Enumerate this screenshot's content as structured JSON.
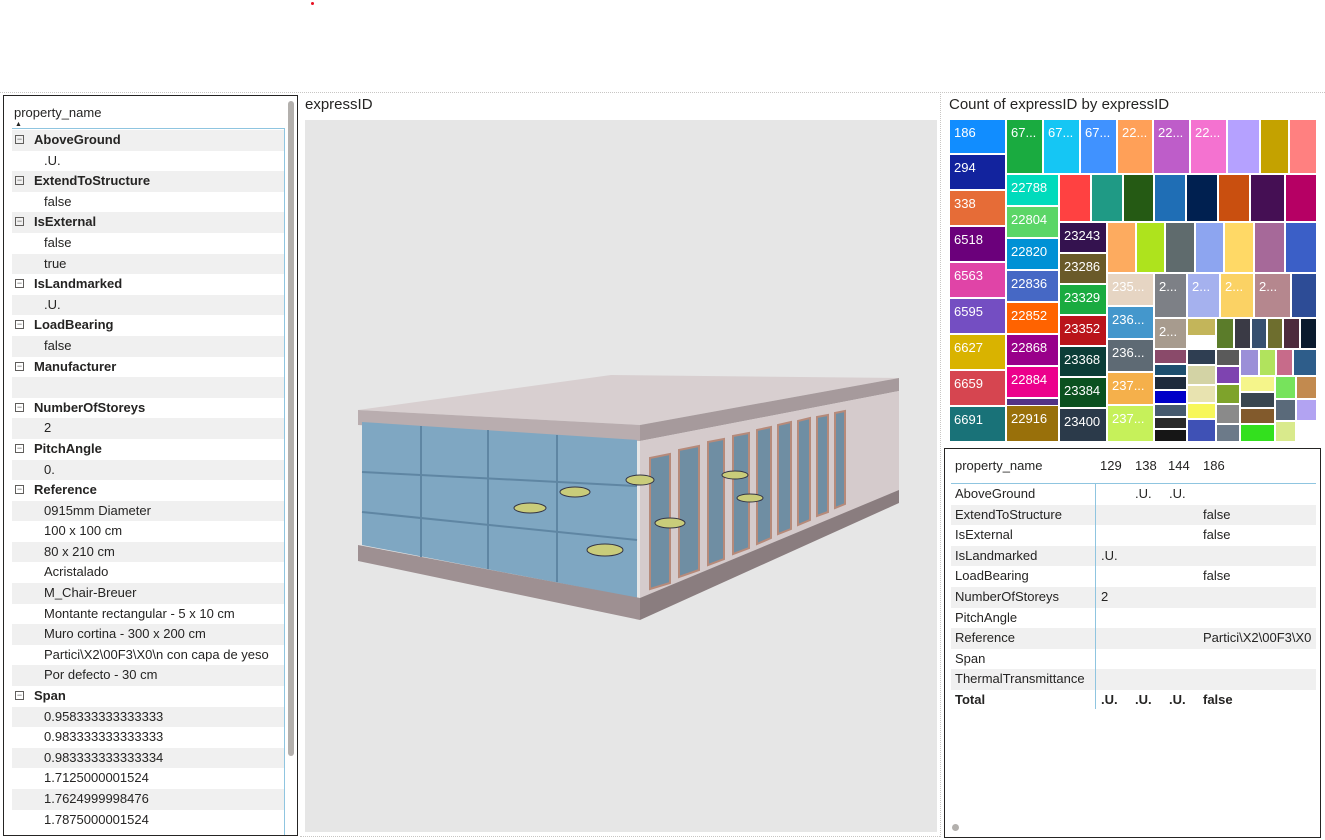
{
  "slicer": {
    "header": "property_name",
    "rows": [
      {
        "type": "cat",
        "text": "AboveGround"
      },
      {
        "type": "val",
        "text": ".U."
      },
      {
        "type": "cat",
        "text": "ExtendToStructure"
      },
      {
        "type": "val",
        "text": "false"
      },
      {
        "type": "cat",
        "text": "IsExternal"
      },
      {
        "type": "val",
        "text": "false"
      },
      {
        "type": "val",
        "text": "true"
      },
      {
        "type": "cat",
        "text": "IsLandmarked"
      },
      {
        "type": "val",
        "text": ".U."
      },
      {
        "type": "cat",
        "text": "LoadBearing"
      },
      {
        "type": "val",
        "text": "false"
      },
      {
        "type": "cat",
        "text": "Manufacturer"
      },
      {
        "type": "val",
        "text": ""
      },
      {
        "type": "cat",
        "text": "NumberOfStoreys"
      },
      {
        "type": "val",
        "text": "2"
      },
      {
        "type": "cat",
        "text": "PitchAngle"
      },
      {
        "type": "val",
        "text": "0."
      },
      {
        "type": "cat",
        "text": "Reference"
      },
      {
        "type": "val",
        "text": "0915mm Diameter"
      },
      {
        "type": "val",
        "text": "100 x 100 cm"
      },
      {
        "type": "val",
        "text": "80 x 210 cm"
      },
      {
        "type": "val",
        "text": "Acristalado"
      },
      {
        "type": "val",
        "text": "M_Chair-Breuer"
      },
      {
        "type": "val",
        "text": "Montante rectangular - 5 x 10 cm"
      },
      {
        "type": "val",
        "text": "Muro cortina - 300 x 200 cm"
      },
      {
        "type": "val",
        "text": "Partici\\X2\\00F3\\X0\\n con capa de yeso"
      },
      {
        "type": "val",
        "text": "Por defecto - 30 cm"
      },
      {
        "type": "cat",
        "text": "Span"
      },
      {
        "type": "val",
        "text": "0.958333333333333"
      },
      {
        "type": "val",
        "text": "0.983333333333333"
      },
      {
        "type": "val",
        "text": "0.983333333333334"
      },
      {
        "type": "val",
        "text": "1.7125000001524"
      },
      {
        "type": "val",
        "text": "1.7624999998476"
      },
      {
        "type": "val",
        "text": "1.7875000001524"
      }
    ]
  },
  "viewer": {
    "title": "expressID"
  },
  "treemap": {
    "title": "Count of expressID by expressID",
    "cells": [
      {
        "label": "186",
        "color": "#118dff"
      },
      {
        "label": "294",
        "color": "#12239e"
      },
      {
        "label": "338",
        "color": "#e66c37"
      },
      {
        "label": "6518",
        "color": "#6b007b"
      },
      {
        "label": "6563",
        "color": "#e044a7"
      },
      {
        "label": "6595",
        "color": "#744ec2"
      },
      {
        "label": "6627",
        "color": "#d9b300"
      },
      {
        "label": "6659",
        "color": "#d64550"
      },
      {
        "label": "6691",
        "color": "#197278"
      },
      {
        "label": "67...",
        "color": "#1aab40"
      },
      {
        "label": "67...",
        "color": "#15c6f4"
      },
      {
        "label": "67...",
        "color": "#4092ff"
      },
      {
        "label": "22...",
        "color": "#ffa058"
      },
      {
        "label": "22...",
        "color": "#be5dc9"
      },
      {
        "label": "22...",
        "color": "#f472d0"
      },
      {
        "label": "",
        "color": "#b5a1ff"
      },
      {
        "label": "",
        "color": "#c4a200"
      },
      {
        "label": "",
        "color": "#ff8080"
      },
      {
        "label": "22788",
        "color": "#00dbbc"
      },
      {
        "label": "22804",
        "color": "#5bd667"
      },
      {
        "label": "22820",
        "color": "#0091d5"
      },
      {
        "label": "22836",
        "color": "#4668c5"
      },
      {
        "label": "22852",
        "color": "#ff6300"
      },
      {
        "label": "22868",
        "color": "#99008a"
      },
      {
        "label": "22884",
        "color": "#ec008c"
      },
      {
        "label": "22900",
        "color": "#533285"
      },
      {
        "label": "22916",
        "color": "#99700a"
      },
      {
        "label": "",
        "color": "#ff4141"
      },
      {
        "label": "",
        "color": "#1f9a85"
      },
      {
        "label": "",
        "color": "#255a14"
      },
      {
        "label": "",
        "color": "#1f6eb5"
      },
      {
        "label": "",
        "color": "#002050"
      },
      {
        "label": "",
        "color": "#c94f0f"
      },
      {
        "label": "",
        "color": "#450f54"
      },
      {
        "label": "",
        "color": "#b60064"
      },
      {
        "label": "23243",
        "color": "#34124f"
      },
      {
        "label": "23286",
        "color": "#6a5a29"
      },
      {
        "label": "23329",
        "color": "#1aab40"
      },
      {
        "label": "23352",
        "color": "#ba141a"
      },
      {
        "label": "23368",
        "color": "#0c3d37"
      },
      {
        "label": "23384",
        "color": "#0b511f"
      },
      {
        "label": "23400",
        "color": "#2b3a4a"
      },
      {
        "label": "",
        "color": "#fdab5f"
      },
      {
        "label": "",
        "color": "#aee31d"
      },
      {
        "label": "",
        "color": "#5f6b6d"
      },
      {
        "label": "",
        "color": "#8da5f0"
      },
      {
        "label": "",
        "color": "#ffd966"
      },
      {
        "label": "",
        "color": "#a66999"
      },
      {
        "label": "",
        "color": "#3b5fc7"
      },
      {
        "label": "235...",
        "color": "#e6d5c3"
      },
      {
        "label": "236...",
        "color": "#4497cc"
      },
      {
        "label": "236...",
        "color": "#5e6a74"
      },
      {
        "label": "237...",
        "color": "#f5b04b"
      },
      {
        "label": "237...",
        "color": "#c6f15a"
      },
      {
        "label": "2...",
        "color": "#7d8086"
      },
      {
        "label": "2...",
        "color": "#a5b1ee"
      },
      {
        "label": "2...",
        "color": "#fbd264"
      },
      {
        "label": "2...",
        "color": "#b5878e"
      },
      {
        "label": "",
        "color": "#2d4c96"
      },
      {
        "label": "2...",
        "color": "#a79b8e"
      },
      {
        "label": "",
        "color": "#c3b55a"
      },
      {
        "label": "",
        "color": "#5b7c2a"
      },
      {
        "label": "",
        "color": "#3a3a45"
      },
      {
        "label": "",
        "color": "#37506f"
      },
      {
        "label": "",
        "color": "#6e6e2e"
      },
      {
        "label": "",
        "color": "#4d2b3d"
      },
      {
        "label": "",
        "color": "#0a1a2e"
      },
      {
        "label": "",
        "color": "#8a4a6a"
      },
      {
        "label": "",
        "color": "#1d4f6e"
      },
      {
        "label": "",
        "color": "#2f3e52"
      },
      {
        "label": "",
        "color": "#5a5a5a"
      },
      {
        "label": "",
        "color": "#9b8fd8"
      },
      {
        "label": "",
        "color": "#b1e35d"
      },
      {
        "label": "",
        "color": "#c76b8a"
      },
      {
        "label": "",
        "color": "#2e5d8a"
      },
      {
        "label": "",
        "color": "#1e2b3c"
      },
      {
        "label": "",
        "color": "#0000c8"
      },
      {
        "label": "",
        "color": "#d3d3a5"
      },
      {
        "label": "",
        "color": "#7e44b0"
      },
      {
        "label": "",
        "color": "#f5f58a"
      },
      {
        "label": "",
        "color": "#77e35c"
      },
      {
        "label": "",
        "color": "#c28a4f"
      },
      {
        "label": "",
        "color": "#465a6e"
      },
      {
        "label": "",
        "color": "#2a2a2a"
      },
      {
        "label": "",
        "color": "#e8e3b0"
      },
      {
        "label": "",
        "color": "#7ea32b"
      },
      {
        "label": "",
        "color": "#39464f"
      },
      {
        "label": "",
        "color": "#161616"
      },
      {
        "label": "",
        "color": "#f7f75a"
      },
      {
        "label": "",
        "color": "#3f51b5"
      },
      {
        "label": "",
        "color": "#8a8a8a"
      },
      {
        "label": "",
        "color": "#6c7a89"
      },
      {
        "label": "",
        "color": "#825a2c"
      },
      {
        "label": "",
        "color": "#33e01e"
      },
      {
        "label": "",
        "color": "#5a6a7a"
      },
      {
        "label": "",
        "color": "#b2a3f2"
      },
      {
        "label": "",
        "color": "#d9ea8c"
      }
    ]
  },
  "matrix": {
    "headers": [
      "property_name",
      "129",
      "138",
      "144",
      "186"
    ],
    "rows": [
      [
        "AboveGround",
        "",
        ".U.",
        ".U.",
        ""
      ],
      [
        "ExtendToStructure",
        "",
        "",
        "",
        "false"
      ],
      [
        "IsExternal",
        "",
        "",
        "",
        "false"
      ],
      [
        "IsLandmarked",
        ".U.",
        "",
        "",
        ""
      ],
      [
        "LoadBearing",
        "",
        "",
        "",
        "false"
      ],
      [
        "NumberOfStoreys",
        "2",
        "",
        "",
        ""
      ],
      [
        "PitchAngle",
        "",
        "",
        "",
        ""
      ],
      [
        "Reference",
        "",
        "",
        "",
        "Partici\\X2\\00F3\\X0"
      ],
      [
        "Span",
        "",
        "",
        "",
        ""
      ],
      [
        "ThermalTransmittance",
        "",
        "",
        "",
        ""
      ]
    ],
    "total": [
      "Total",
      ".U.",
      ".U.",
      ".U.",
      "false"
    ]
  }
}
